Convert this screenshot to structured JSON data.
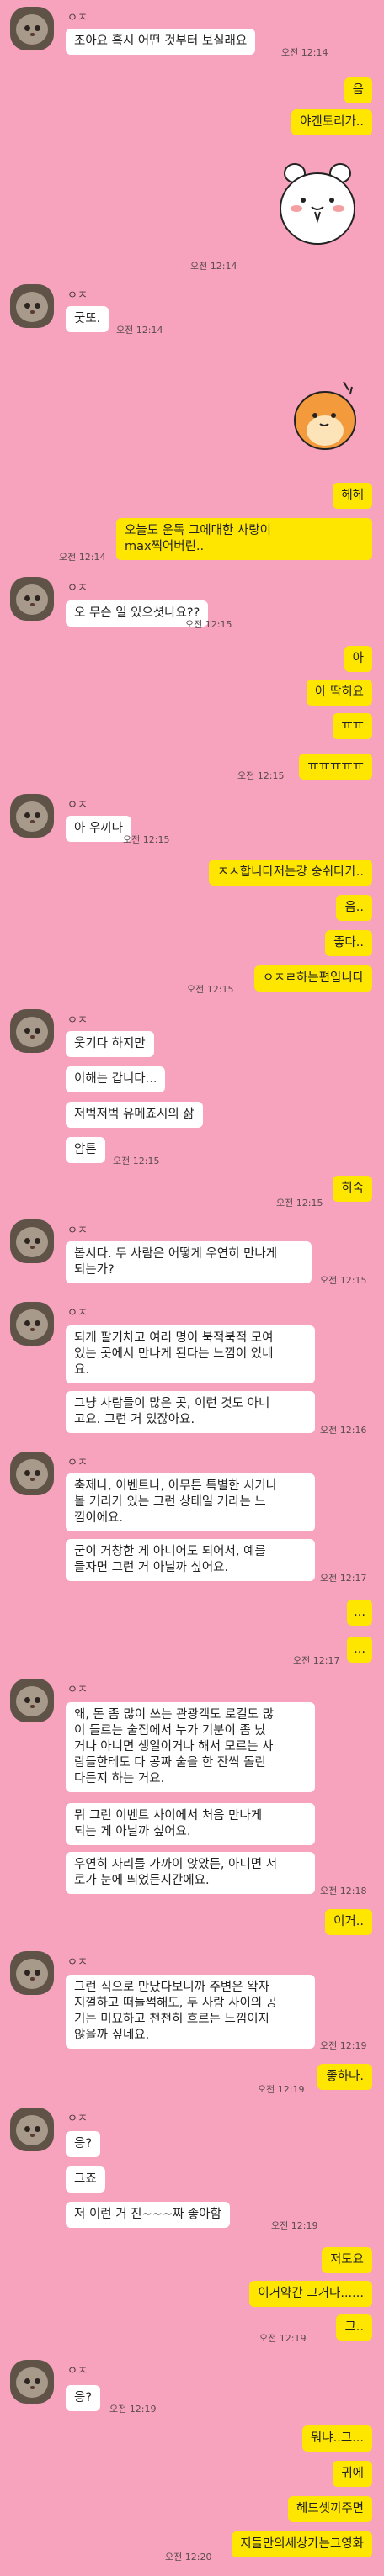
{
  "contact_name": "ㅇㅈ",
  "msgs": [
    {
      "text": "조아요 혹시 어떤 것부터 보실래요"
    },
    {
      "text": "음"
    },
    {
      "text": "야겐토리가.."
    },
    {
      "text": "굿또."
    },
    {
      "text": "헤헤"
    },
    {
      "text": "오늘도 운독 그에대한 사랑이\nmax찍어버린.."
    },
    {
      "text": "오 무슨 일 있으셧나요??"
    },
    {
      "text": "아"
    },
    {
      "text": "아 딱히요"
    },
    {
      "text": "ㅠㅠ"
    },
    {
      "text": "ㅠㅠㅠㅠㅠ"
    },
    {
      "text": "아 우끼다"
    },
    {
      "text": "ㅈㅅ합니다저는걍 숭쉬다가.."
    },
    {
      "text": "음.."
    },
    {
      "text": "좋다.."
    },
    {
      "text": "ㅇㅈㄹ하는편입니다"
    },
    {
      "text": "웃기다 하지만"
    },
    {
      "text": "이해는 갑니다..."
    },
    {
      "text": "저벅저벅 유메죠시의 삶"
    },
    {
      "text": "암튼"
    },
    {
      "text": "히죽"
    },
    {
      "text": "봅시다. 두 사람은 어떻게 우연히 만나게\n되는가?"
    },
    {
      "text": "되게 팔기차고 여러 명이 북적북적 모여\n있는 곳에서 만나게 된다는 느낌이 있네\n요."
    },
    {
      "text": "그냥 사람들이 많은 곳, 이런 것도 아니\n고요. 그런 거 있잖아요."
    },
    {
      "text": "축제나, 이벤트나, 아무튼 특별한 시기나\n볼 거리가 있는 그런 상태일 거라는 느\n낌이에요."
    },
    {
      "text": "굳이 거창한 게 아니어도 되어서, 예를\n들자면 그런 거 아닐까 싶어요."
    },
    {
      "text": "..."
    },
    {
      "text": "..."
    },
    {
      "text": "왜, 돈 좀 많이 쓰는 관광객도 로컬도 많\n이 들르는 술집에서 누가 기분이 좀 났\n거나 아니면 생일이거나 해서 모르는 사\n람들한테도 다 공짜 술을 한 잔씩 돌린\n다든지 하는 거요."
    },
    {
      "text": "뭐 그런 이벤트 사이에서 처음 만나게\n되는 게 아닐까 싶어요."
    },
    {
      "text": "우연히 자리를 가까이 앉았든, 아니면 서\n로가 눈에 띄었든지간에요."
    },
    {
      "text": "이거.."
    },
    {
      "text": "그런 식으로 만났다보니까 주변은 왁자\n지껄하고 떠들썩해도, 두 사람 사이의 공\n기는 미묘하고 천천히 흐르는 느낌이지\n않을까 싶네요."
    },
    {
      "text": "좋하다."
    },
    {
      "text": "응?"
    },
    {
      "text": "그죠"
    },
    {
      "text": "저 이런 거 진~~~짜 좋아함"
    },
    {
      "text": "저도요"
    },
    {
      "text": "이거약간 그거다......"
    },
    {
      "text": "그.."
    },
    {
      "text": "응?"
    },
    {
      "text": "뭐냐..그..."
    },
    {
      "text": "귀에"
    },
    {
      "text": "헤드셋끼주면"
    },
    {
      "text": "지들만의세상가는그영화"
    }
  ],
  "times": [
    "오전 12:14",
    "오전 12:14",
    "오전 12:14",
    "오전 12:14",
    "오전 12:15",
    "오전 12:15",
    "오전 12:15",
    "오전 12:15",
    "오전 12:15",
    "오전 12:15",
    "오전 12:15",
    "오전 12:16",
    "오전 12:17",
    "오전 12:17",
    "오전 12:18",
    "오전 12:19",
    "오전 12:19",
    "오전 12:19",
    "오전 12:19",
    "오전 12:19",
    "오전 12:19",
    "오전 12:19",
    "오전 12:20"
  ]
}
